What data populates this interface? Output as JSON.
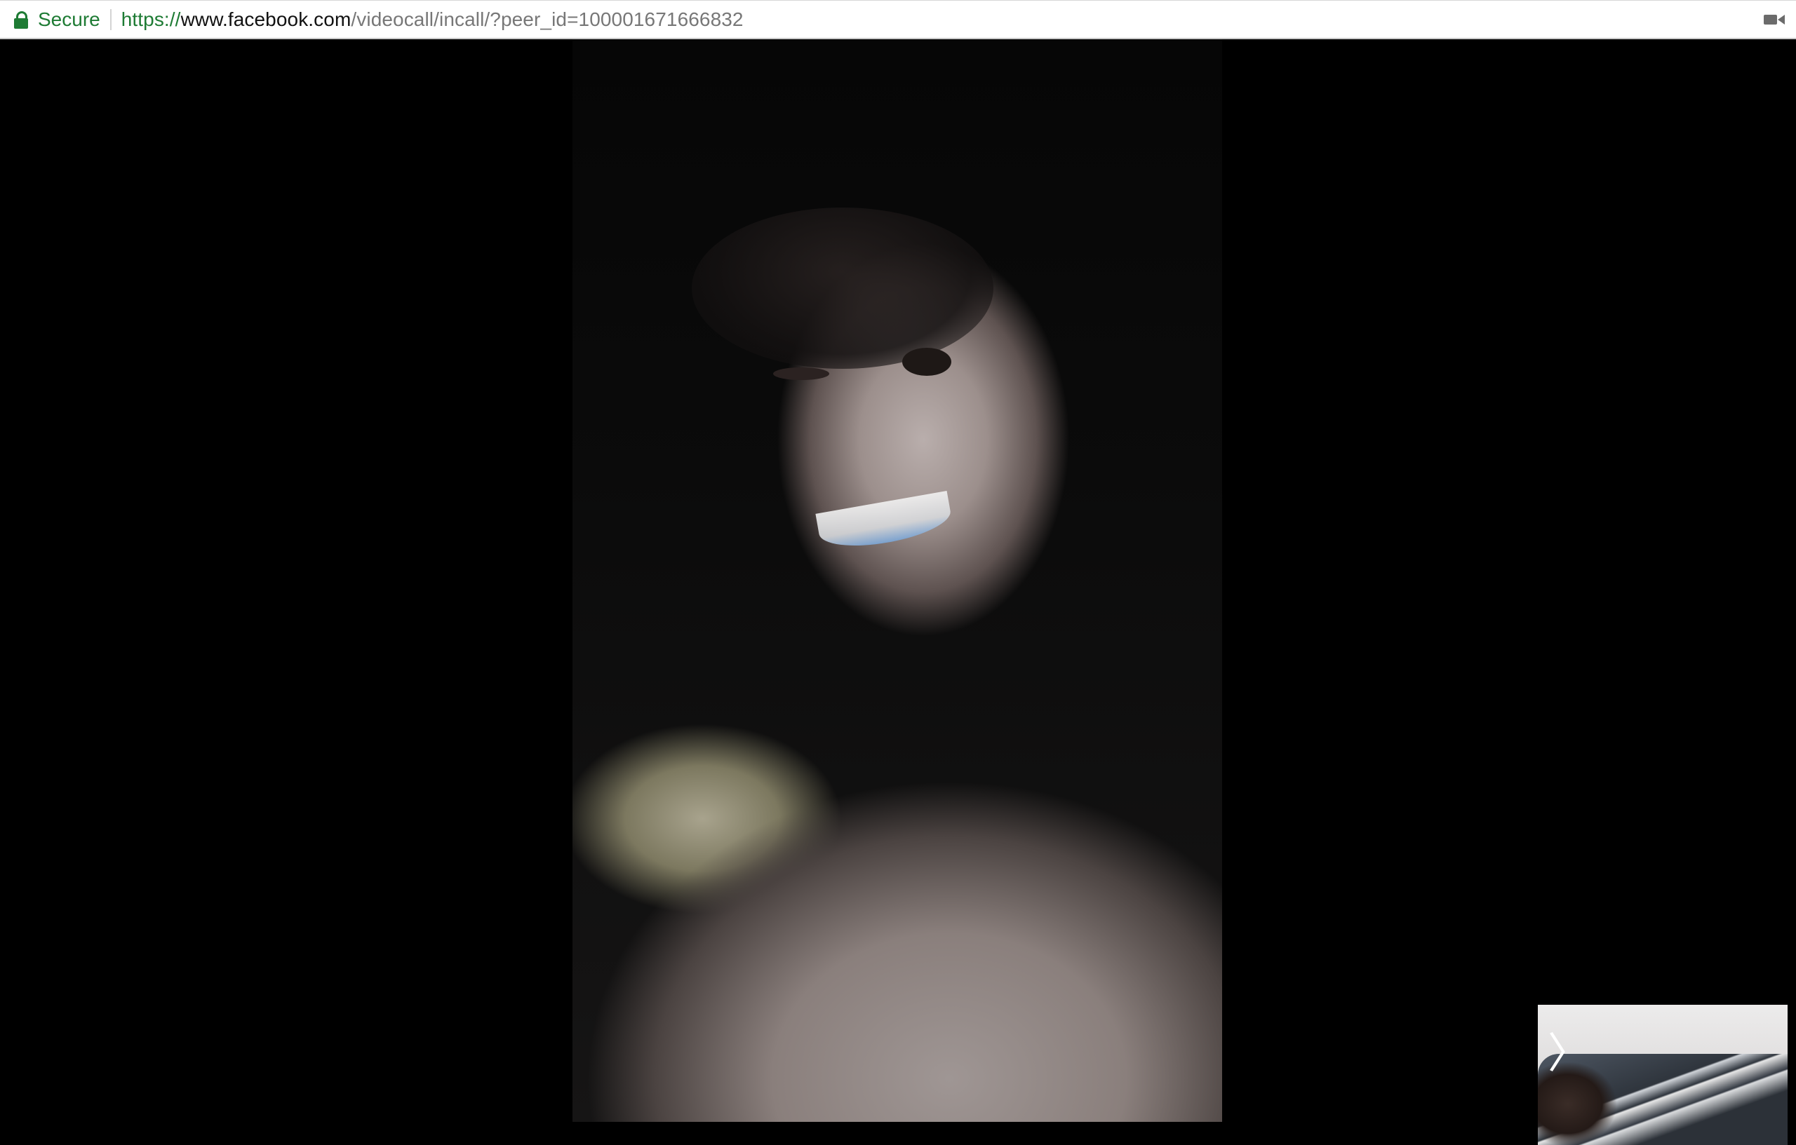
{
  "browser": {
    "security_label": "Secure",
    "url": {
      "scheme": "https://",
      "host": "www.facebook.com",
      "path": "/videocall/incall/?peer_id=100001671666832"
    },
    "icons": {
      "lock": "lock-icon",
      "camera": "camera-icon"
    },
    "colors": {
      "secure_green": "#1e7b34",
      "bar_background": "#ffffff"
    }
  },
  "call": {
    "background": "#000000",
    "self_view_toggle_glyph": "〉"
  }
}
